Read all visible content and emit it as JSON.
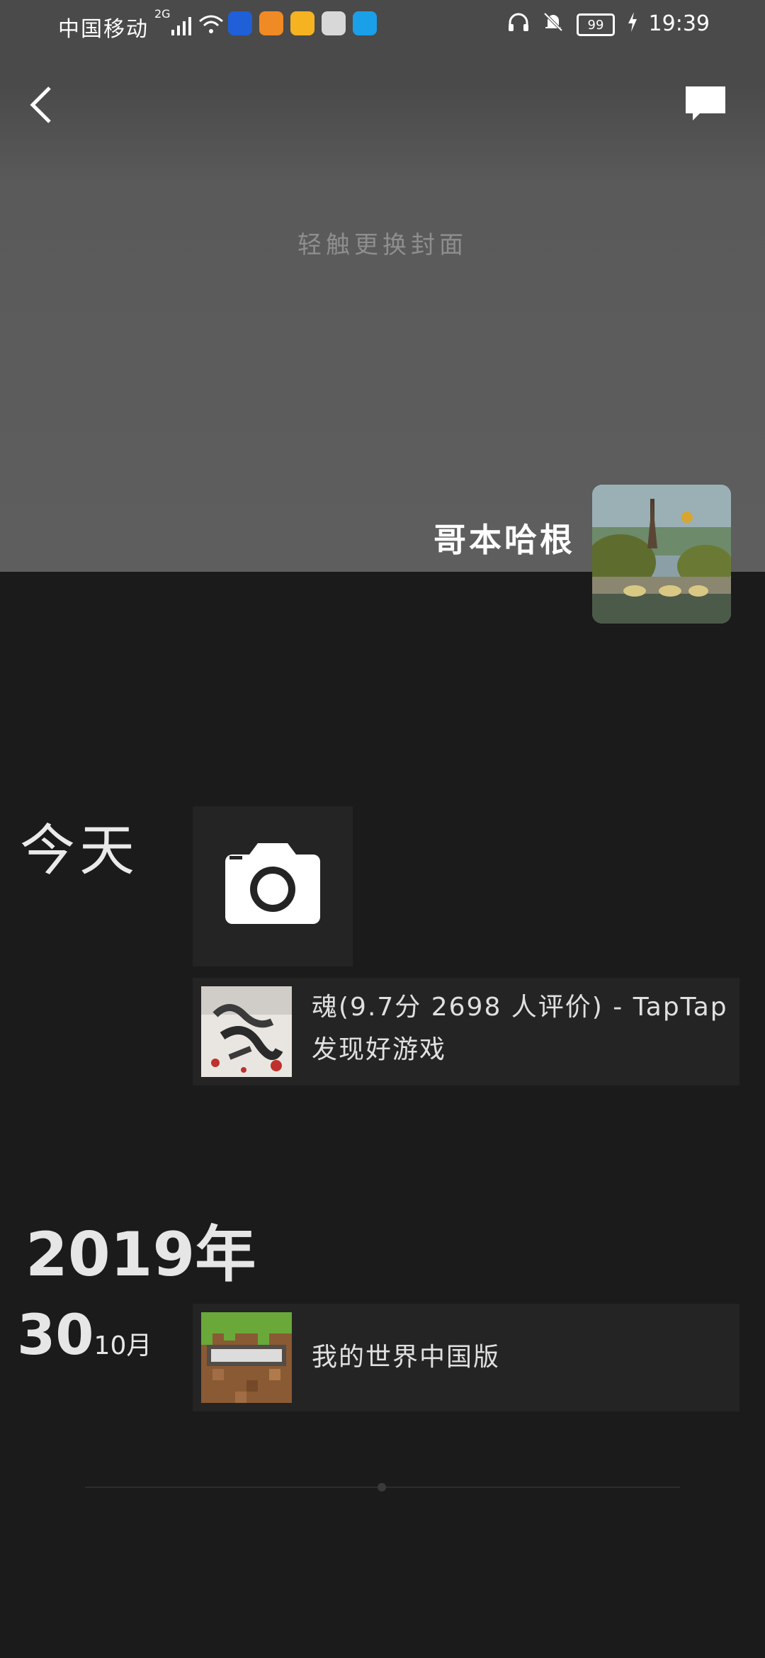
{
  "status_bar": {
    "carrier": "中国移动",
    "network": "2G",
    "battery": "99",
    "time": "19:39"
  },
  "cover": {
    "change_cover_hint": "轻触更换封面",
    "username": "哥本哈根"
  },
  "timeline": {
    "today_label": "今天",
    "today_post": {
      "title": "魂(9.7分 2698 人评价) - TapTap",
      "subtitle": "发现好游戏"
    },
    "year_label": "2019年",
    "entry_2019": {
      "day": "30",
      "month": "10月",
      "title": "我的世界中国版"
    }
  }
}
